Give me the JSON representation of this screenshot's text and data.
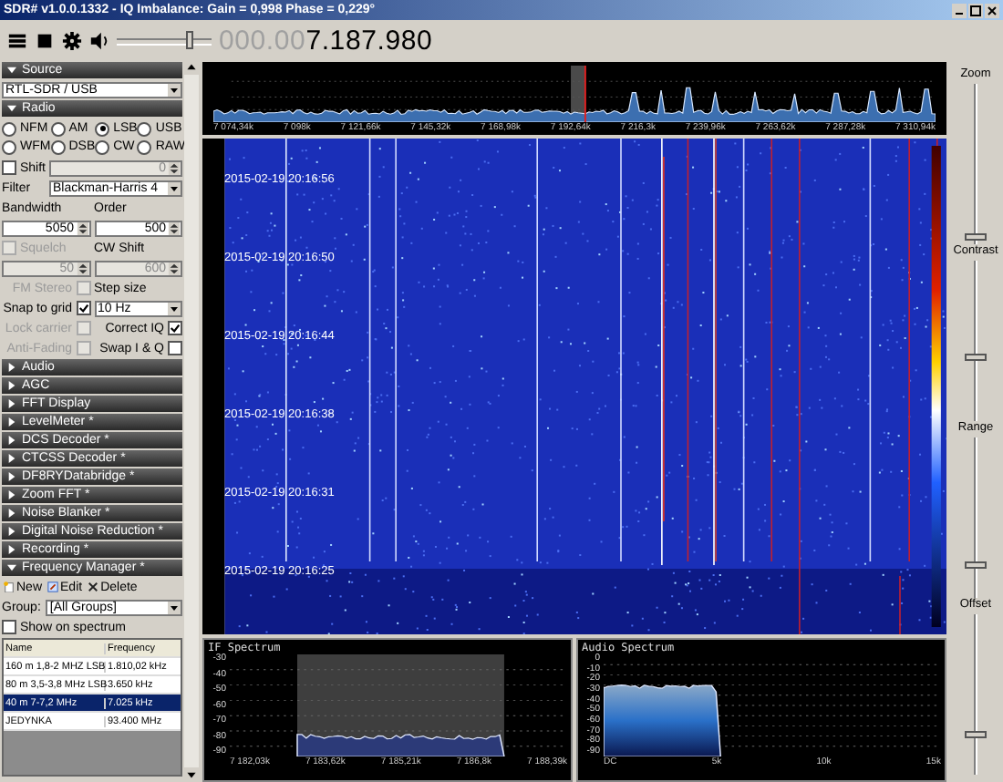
{
  "window": {
    "title": "SDR# v1.0.0.1332 - IQ Imbalance: Gain = 0,998 Phase = 0,229°"
  },
  "toolbar": {
    "volume": {
      "level": 0.8
    },
    "frequency_dim": "000.00",
    "frequency": "7.187.980"
  },
  "source": {
    "header": "Source",
    "expanded": true,
    "device": "RTL-SDR / USB"
  },
  "radio": {
    "header": "Radio",
    "expanded": true,
    "modes": [
      {
        "label": "NFM",
        "selected": false
      },
      {
        "label": "AM",
        "selected": false
      },
      {
        "label": "LSB",
        "selected": true
      },
      {
        "label": "USB",
        "selected": false
      },
      {
        "label": "WFM",
        "selected": false
      },
      {
        "label": "DSB",
        "selected": false
      },
      {
        "label": "CW",
        "selected": false
      },
      {
        "label": "RAW",
        "selected": false
      }
    ],
    "rows": [
      [
        {
          "kind": "checkbox",
          "label": "Shift",
          "checked": false,
          "disabled": false
        },
        {
          "kind": "spin",
          "value": "0",
          "disabled": true
        }
      ],
      [
        {
          "kind": "label",
          "text": "Filter"
        },
        {
          "kind": "dropdown",
          "value": "Blackman-Harris 4"
        }
      ],
      [
        {
          "kind": "label",
          "text": "Bandwidth"
        },
        {
          "kind": "label",
          "text": "Order"
        }
      ],
      [
        {
          "kind": "spin",
          "value": "5050",
          "disabled": false
        },
        {
          "kind": "spin",
          "value": "500",
          "disabled": false
        }
      ],
      [
        {
          "kind": "checkbox",
          "label": "Squelch",
          "checked": false,
          "disabled": true
        },
        {
          "kind": "label",
          "text": "CW Shift"
        }
      ],
      [
        {
          "kind": "spin",
          "value": "50",
          "disabled": true
        },
        {
          "kind": "spin",
          "value": "600",
          "disabled": true
        }
      ],
      [
        {
          "kind": "checkbox_right",
          "label": "FM Stereo",
          "checked": false,
          "disabled": true
        },
        {
          "kind": "label",
          "text": "Step size"
        }
      ],
      [
        {
          "kind": "checkbox_right",
          "label": "Snap to grid",
          "checked": true,
          "disabled": false
        },
        {
          "kind": "dropdown",
          "value": "10 Hz"
        }
      ],
      [
        {
          "kind": "checkbox_right",
          "label": "Lock carrier",
          "checked": false,
          "disabled": true
        },
        {
          "kind": "checkbox_right",
          "label": "Correct IQ",
          "checked": true,
          "disabled": false
        }
      ],
      [
        {
          "kind": "checkbox_right",
          "label": "Anti-Fading",
          "checked": false,
          "disabled": true
        },
        {
          "kind": "checkbox_right",
          "label": "Swap I & Q",
          "checked": false,
          "disabled": false
        }
      ]
    ]
  },
  "plugins": [
    {
      "label": "Audio",
      "expanded": false
    },
    {
      "label": "AGC",
      "expanded": false
    },
    {
      "label": "FFT Display",
      "expanded": false
    },
    {
      "label": "LevelMeter *",
      "expanded": false
    },
    {
      "label": "DCS Decoder *",
      "expanded": false
    },
    {
      "label": "CTCSS Decoder *",
      "expanded": false
    },
    {
      "label": "DF8RYDatabridge *",
      "expanded": false
    },
    {
      "label": "Zoom FFT *",
      "expanded": false
    },
    {
      "label": "Noise Blanker *",
      "expanded": false
    },
    {
      "label": "Digital Noise Reduction *",
      "expanded": false
    },
    {
      "label": "Recording *",
      "expanded": false
    }
  ],
  "frequency_manager": {
    "header": "Frequency Manager *",
    "expanded": true,
    "actions": [
      {
        "kind": "new",
        "label": "New"
      },
      {
        "kind": "edit",
        "label": "Edit"
      },
      {
        "kind": "delete",
        "label": "Delete"
      }
    ],
    "group_label": "Group:",
    "group_value": "[All Groups]",
    "show_on_spectrum": {
      "label": "Show on spectrum",
      "checked": false
    },
    "columns": [
      "Name",
      "Frequency"
    ],
    "rows": [
      {
        "name": "160 m 1,8-2 MHZ LSB",
        "frequency": "1.810,02 kHz",
        "selected": false
      },
      {
        "name": "80 m 3,5-3,8 MHz LSB",
        "frequency": "3.650 kHz",
        "selected": false
      },
      {
        "name": "40 m 7-7,2 MHz",
        "frequency": "7.025 kHz",
        "selected": true
      },
      {
        "name": "JEDYNKA",
        "frequency": "93.400 MHz",
        "selected": false
      }
    ]
  },
  "spectrum": {
    "x_labels": [
      "7 074,34k",
      "7 098k",
      "7 121,66k",
      "7 145,32k",
      "7 168,98k",
      "7 192,64k",
      "7 216,3k",
      "7 239,96k",
      "7 263,62k",
      "7 287,28k",
      "7 310,94k"
    ]
  },
  "waterfall": {
    "timestamps": [
      "2015-02-19 20:16:56",
      "2015-02-19 20:16:50",
      "2015-02-19 20:16:44",
      "2015-02-19 20:16:38",
      "2015-02-19 20:16:31",
      "2015-02-19 20:16:25"
    ]
  },
  "if_spectrum": {
    "title": "IF Spectrum",
    "y_labels": [
      "-30",
      "-40",
      "-50",
      "-60",
      "-70",
      "-80",
      "-90"
    ],
    "x_labels": [
      "7 182,03k",
      "7 183,62k",
      "7 185,21k",
      "7 186,8k",
      "7 188,39k"
    ]
  },
  "audio_spectrum": {
    "title": "Audio Spectrum",
    "y_labels": [
      "0",
      "-10",
      "-20",
      "-30",
      "-40",
      "-50",
      "-60",
      "-70",
      "-80",
      "-90"
    ],
    "x_labels": [
      "DC",
      "5k",
      "10k",
      "15k"
    ]
  },
  "side_controls": [
    {
      "label": "Zoom",
      "level": 0.05
    },
    {
      "label": "Contrast",
      "level": 0.4
    },
    {
      "label": "Range",
      "level": 0.2
    },
    {
      "label": "Offset",
      "level": 0.25
    }
  ]
}
